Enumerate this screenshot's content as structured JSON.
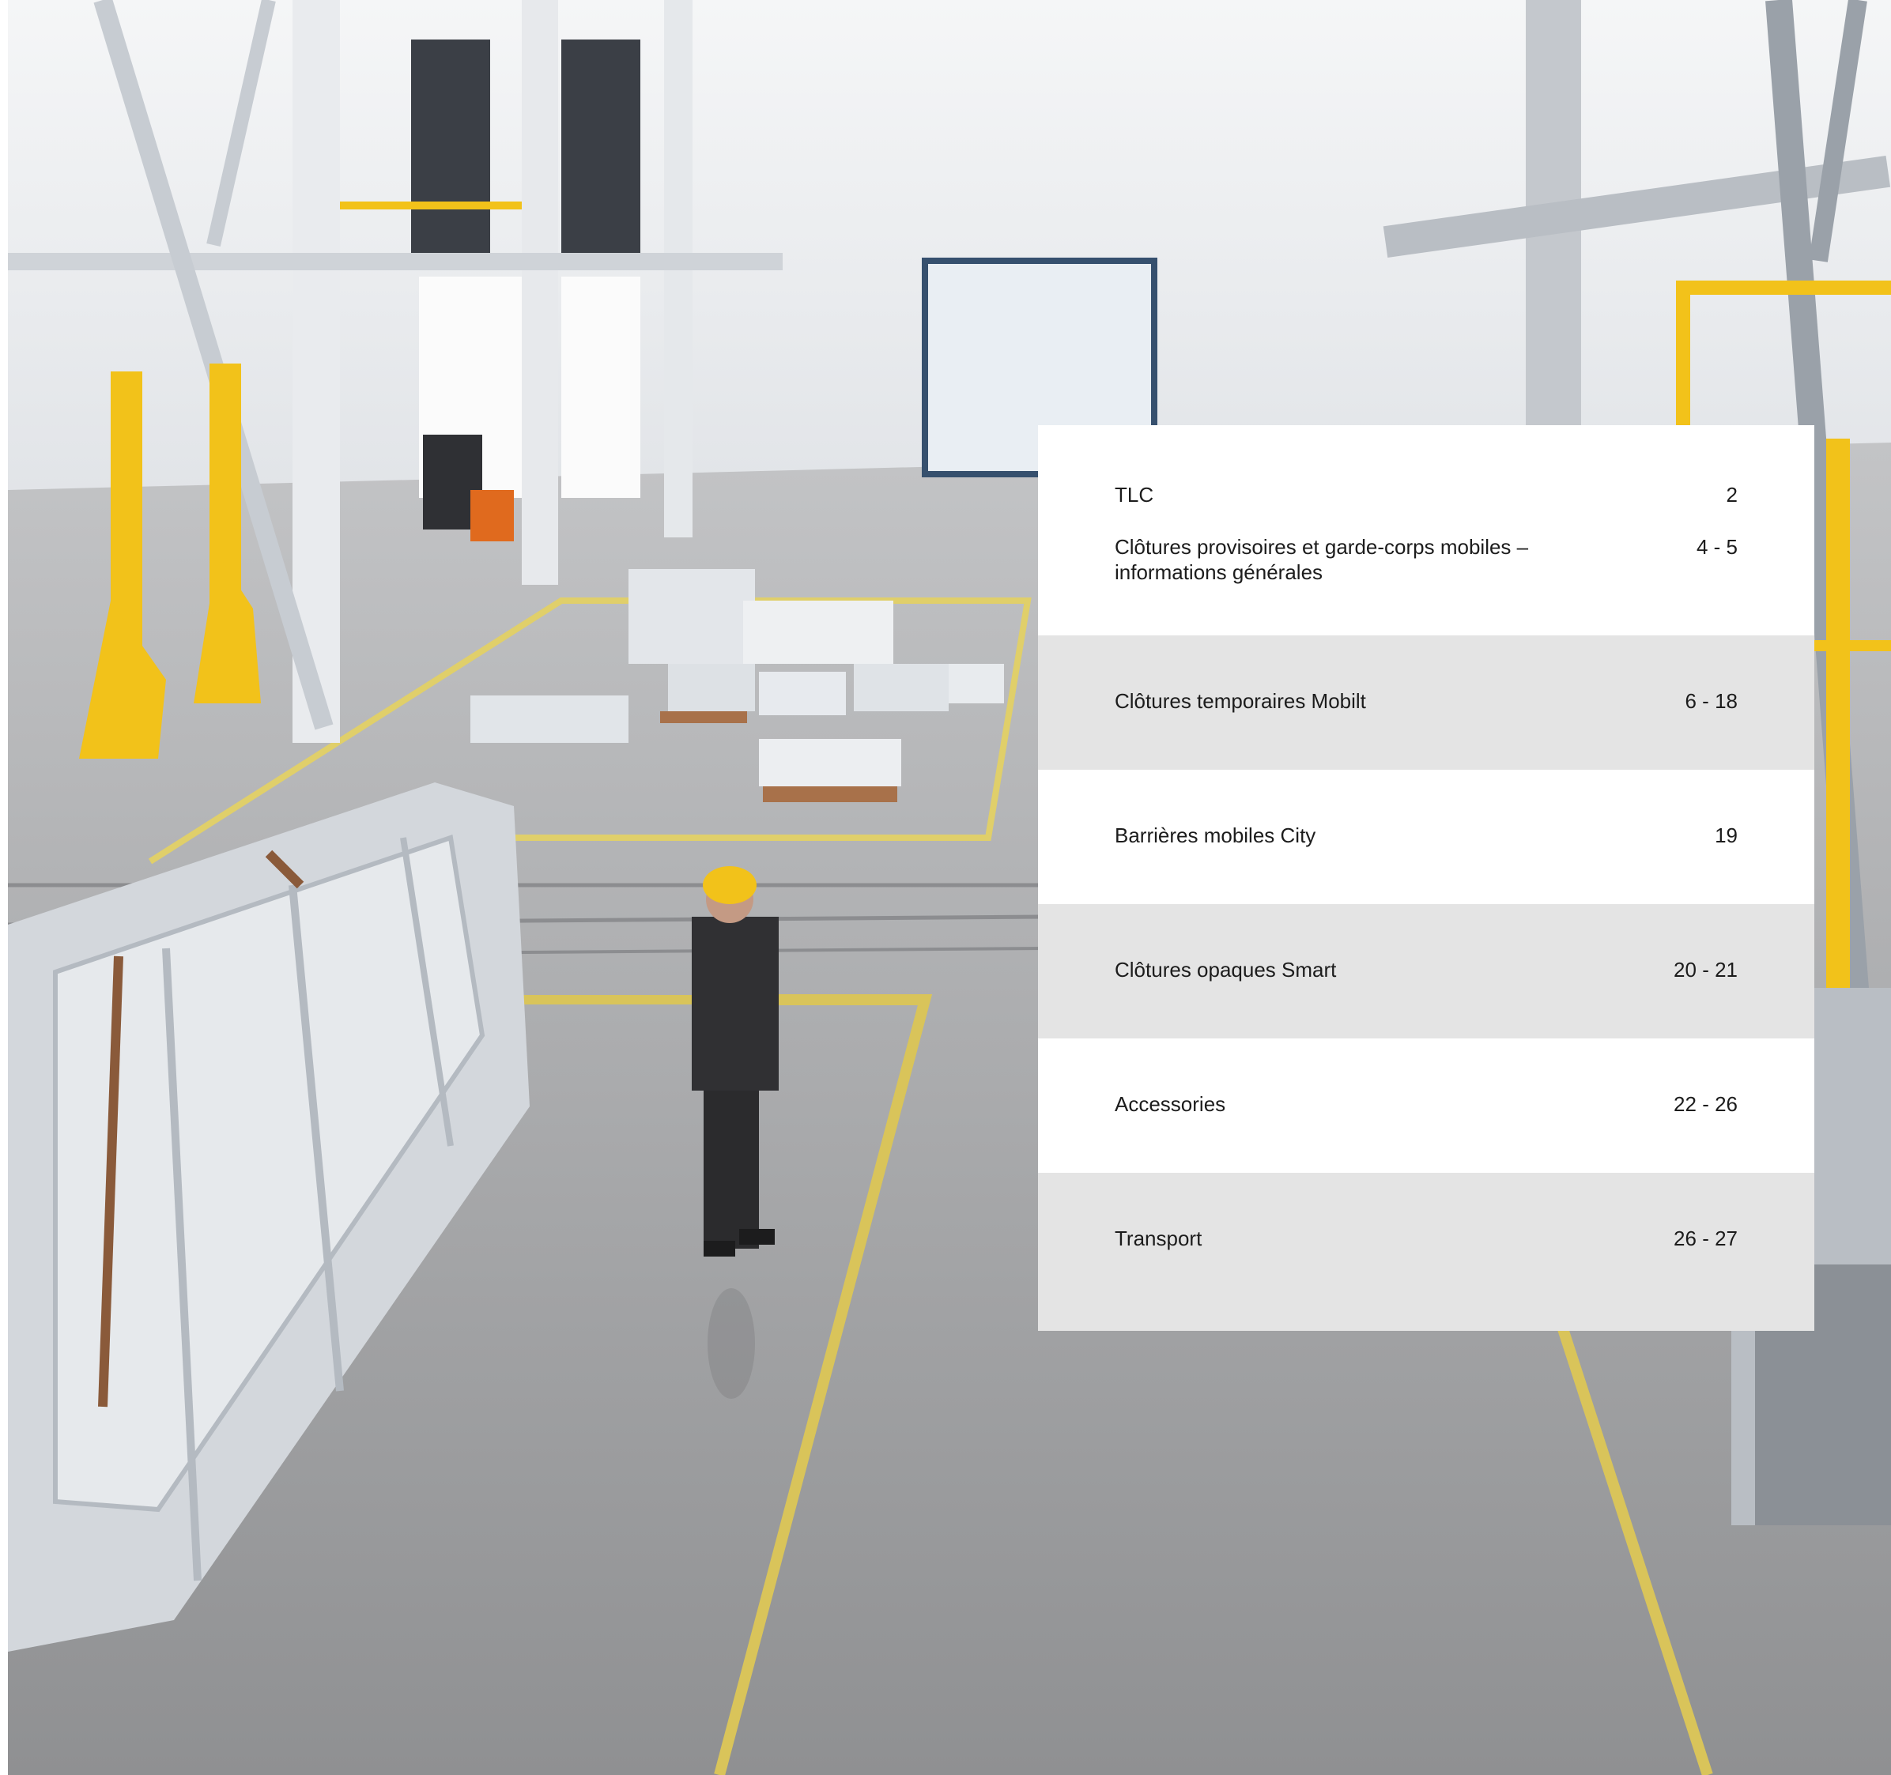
{
  "toc": {
    "entries": [
      {
        "title_lines": [
          "TLC"
        ],
        "pages": "2"
      },
      {
        "title_lines": [
          "Clôtures provisoires et garde-corps mobiles –",
          "informations générales"
        ],
        "pages": "4 - 5"
      },
      {
        "title_lines": [
          "Clôtures temporaires Mobilt"
        ],
        "pages": "6 - 18"
      },
      {
        "title_lines": [
          "Barrières mobiles City"
        ],
        "pages": "19"
      },
      {
        "title_lines": [
          "Clôtures opaques Smart"
        ],
        "pages": "20 - 21"
      },
      {
        "title_lines": [
          "Accessories"
        ],
        "pages": "22 - 26"
      },
      {
        "title_lines": [
          "Transport"
        ],
        "pages": "26 - 27"
      }
    ]
  },
  "colors": {
    "panel_white": "#ffffff",
    "panel_grey": "#e4e4e4",
    "text": "#1c1c1c",
    "floor": "#a9a9a9",
    "safety_yellow": "#f2c21a",
    "steel": "#d7dbe0"
  },
  "photo": {
    "icons": [
      "warehouse-photo"
    ]
  }
}
